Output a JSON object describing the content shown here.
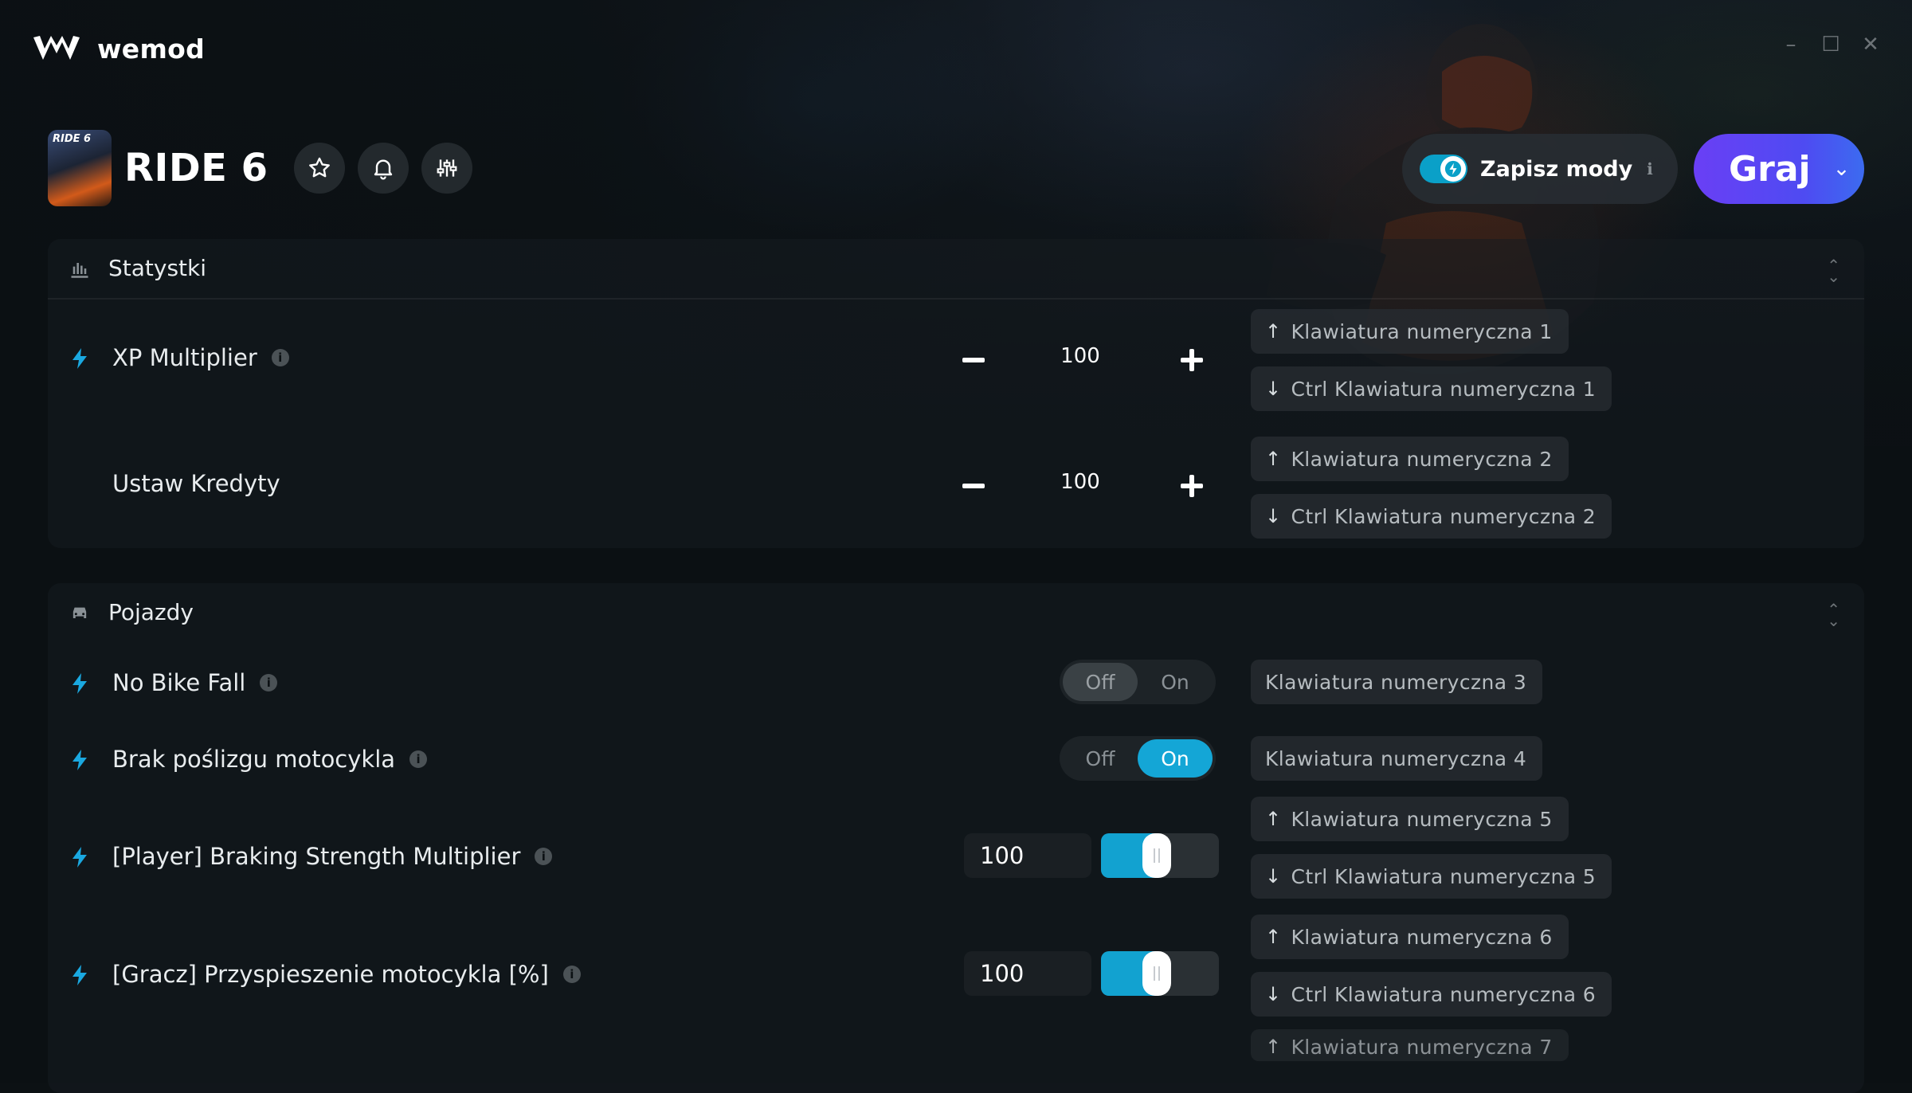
{
  "app": {
    "brand": "wemod"
  },
  "game": {
    "title": "RIDE 6",
    "cover_text": "RIDE 6"
  },
  "header": {
    "save_mods_label": "Zapisz mody",
    "save_mods_on": true,
    "play_label": "Graj"
  },
  "sections": [
    {
      "id": "stats",
      "label": "Statystki",
      "icon": "bar-chart-icon",
      "rows": [
        {
          "label": "XP Multiplier",
          "has_bolt": true,
          "has_info": true,
          "control": "stepper",
          "value": "100",
          "keys": [
            {
              "dir": "up",
              "text": "Klawiatura numeryczna 1"
            },
            {
              "dir": "down",
              "text": "Ctrl Klawiatura numeryczna 1"
            }
          ]
        },
        {
          "label": "Ustaw Kredyty",
          "has_bolt": false,
          "has_info": false,
          "control": "stepper",
          "value": "100",
          "keys": [
            {
              "dir": "up",
              "text": "Klawiatura numeryczna 2"
            },
            {
              "dir": "down",
              "text": "Ctrl Klawiatura numeryczna 2"
            }
          ]
        }
      ]
    },
    {
      "id": "vehicles",
      "label": "Pojazdy",
      "icon": "car-icon",
      "rows": [
        {
          "label": "No Bike Fall",
          "has_bolt": true,
          "has_info": true,
          "control": "toggle",
          "state": "Off",
          "off_label": "Off",
          "on_label": "On",
          "keys": [
            {
              "dir": "",
              "text": "Klawiatura numeryczna 3"
            }
          ]
        },
        {
          "label": "Brak poślizgu motocykla",
          "has_bolt": true,
          "has_info": true,
          "control": "toggle",
          "state": "On",
          "off_label": "Off",
          "on_label": "On",
          "keys": [
            {
              "dir": "",
              "text": "Klawiatura numeryczna 4"
            }
          ]
        },
        {
          "label": "[Player] Braking Strength Multiplier",
          "has_bolt": true,
          "has_info": true,
          "control": "slider",
          "value": "100",
          "slider_fraction": 0.47,
          "keys": [
            {
              "dir": "up",
              "text": "Klawiatura numeryczna 5"
            },
            {
              "dir": "down",
              "text": "Ctrl Klawiatura numeryczna 5"
            }
          ]
        },
        {
          "label": "[Gracz] Przyspieszenie motocykla [%]",
          "has_bolt": true,
          "has_info": true,
          "control": "slider",
          "value": "100",
          "slider_fraction": 0.47,
          "keys": [
            {
              "dir": "up",
              "text": "Klawiatura numeryczna 6"
            },
            {
              "dir": "down",
              "text": "Ctrl Klawiatura numeryczna 6"
            },
            {
              "dir": "up",
              "text": "Klawiatura numeryczna 7"
            }
          ]
        }
      ]
    }
  ],
  "colors": {
    "accent": "#14a6d6",
    "play_gradient_start": "#6a3ff5",
    "play_gradient_end": "#3c6bf0",
    "bolt": "#1aa8e0"
  }
}
